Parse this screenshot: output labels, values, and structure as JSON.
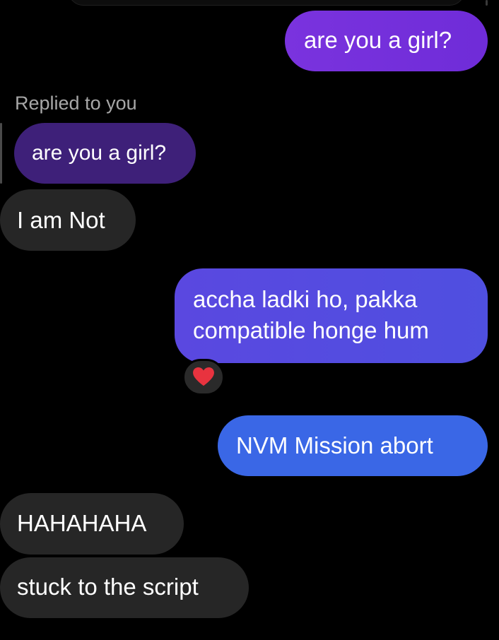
{
  "chat": {
    "messages": [
      {
        "side": "sent",
        "text": "are you a girl?"
      },
      {
        "side": "received",
        "reply_label": "Replied to you",
        "quoted_text": "are you a girl?",
        "text": "I am Not"
      },
      {
        "side": "sent",
        "lines": [
          "accha ladki ho, pakka",
          "compatible honge hum"
        ],
        "reaction": "heart-icon"
      },
      {
        "side": "sent",
        "text": "NVM Mission abort"
      },
      {
        "side": "received",
        "text": "HAHAHAHA"
      },
      {
        "side": "received",
        "text": "stuck to the script"
      }
    ]
  },
  "colors": {
    "background": "#000000",
    "received_bubble": "#262626",
    "sent_purple": "#7a33de",
    "sent_indigo": "#5a48e0",
    "sent_blue": "#3a67e6",
    "reply_quote": "#3e2079",
    "reaction_heart": "#e8333f"
  }
}
